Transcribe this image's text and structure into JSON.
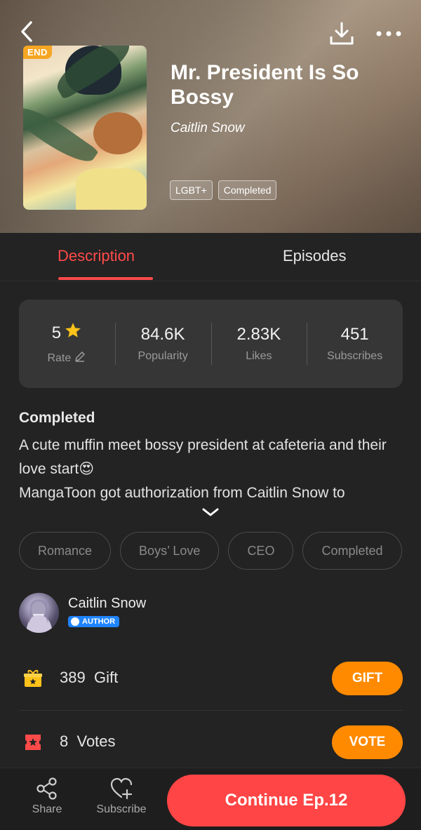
{
  "header": {
    "cover_badge": "END",
    "title": "Mr. President Is So Bossy",
    "author": "Caitlin Snow",
    "tags": [
      "LGBT+",
      "Completed"
    ]
  },
  "tabs": [
    {
      "label": "Description",
      "active": true
    },
    {
      "label": "Episodes",
      "active": false
    }
  ],
  "stats": [
    {
      "value": "5",
      "label": "Rate"
    },
    {
      "value": "84.6K",
      "label": "Popularity"
    },
    {
      "value": "2.83K",
      "label": "Likes"
    },
    {
      "value": "451",
      "label": "Subscribes"
    }
  ],
  "description": {
    "status": "Completed",
    "text_line1": "A cute muffin meet bossy president at cafeteria and their love start😍",
    "text_line2": "MangaToon got authorization from Caitlin Snow to"
  },
  "genres": [
    "Romance",
    "Boys’ Love",
    "CEO",
    "Completed"
  ],
  "author": {
    "name": "Caitlin Snow",
    "badge": "AUTHOR"
  },
  "gift": {
    "count": "389",
    "label": "Gift",
    "button": "GIFT"
  },
  "votes": {
    "count": "8",
    "label": "Votes",
    "button": "VOTE"
  },
  "bottom_bar": {
    "share": "Share",
    "subscribe": "Subscribe",
    "continue": "Continue Ep.12"
  },
  "colors": {
    "accent": "#ff4a4a",
    "button_orange": "#ff8a00",
    "author_badge": "#1f84ff",
    "background": "#232323"
  }
}
